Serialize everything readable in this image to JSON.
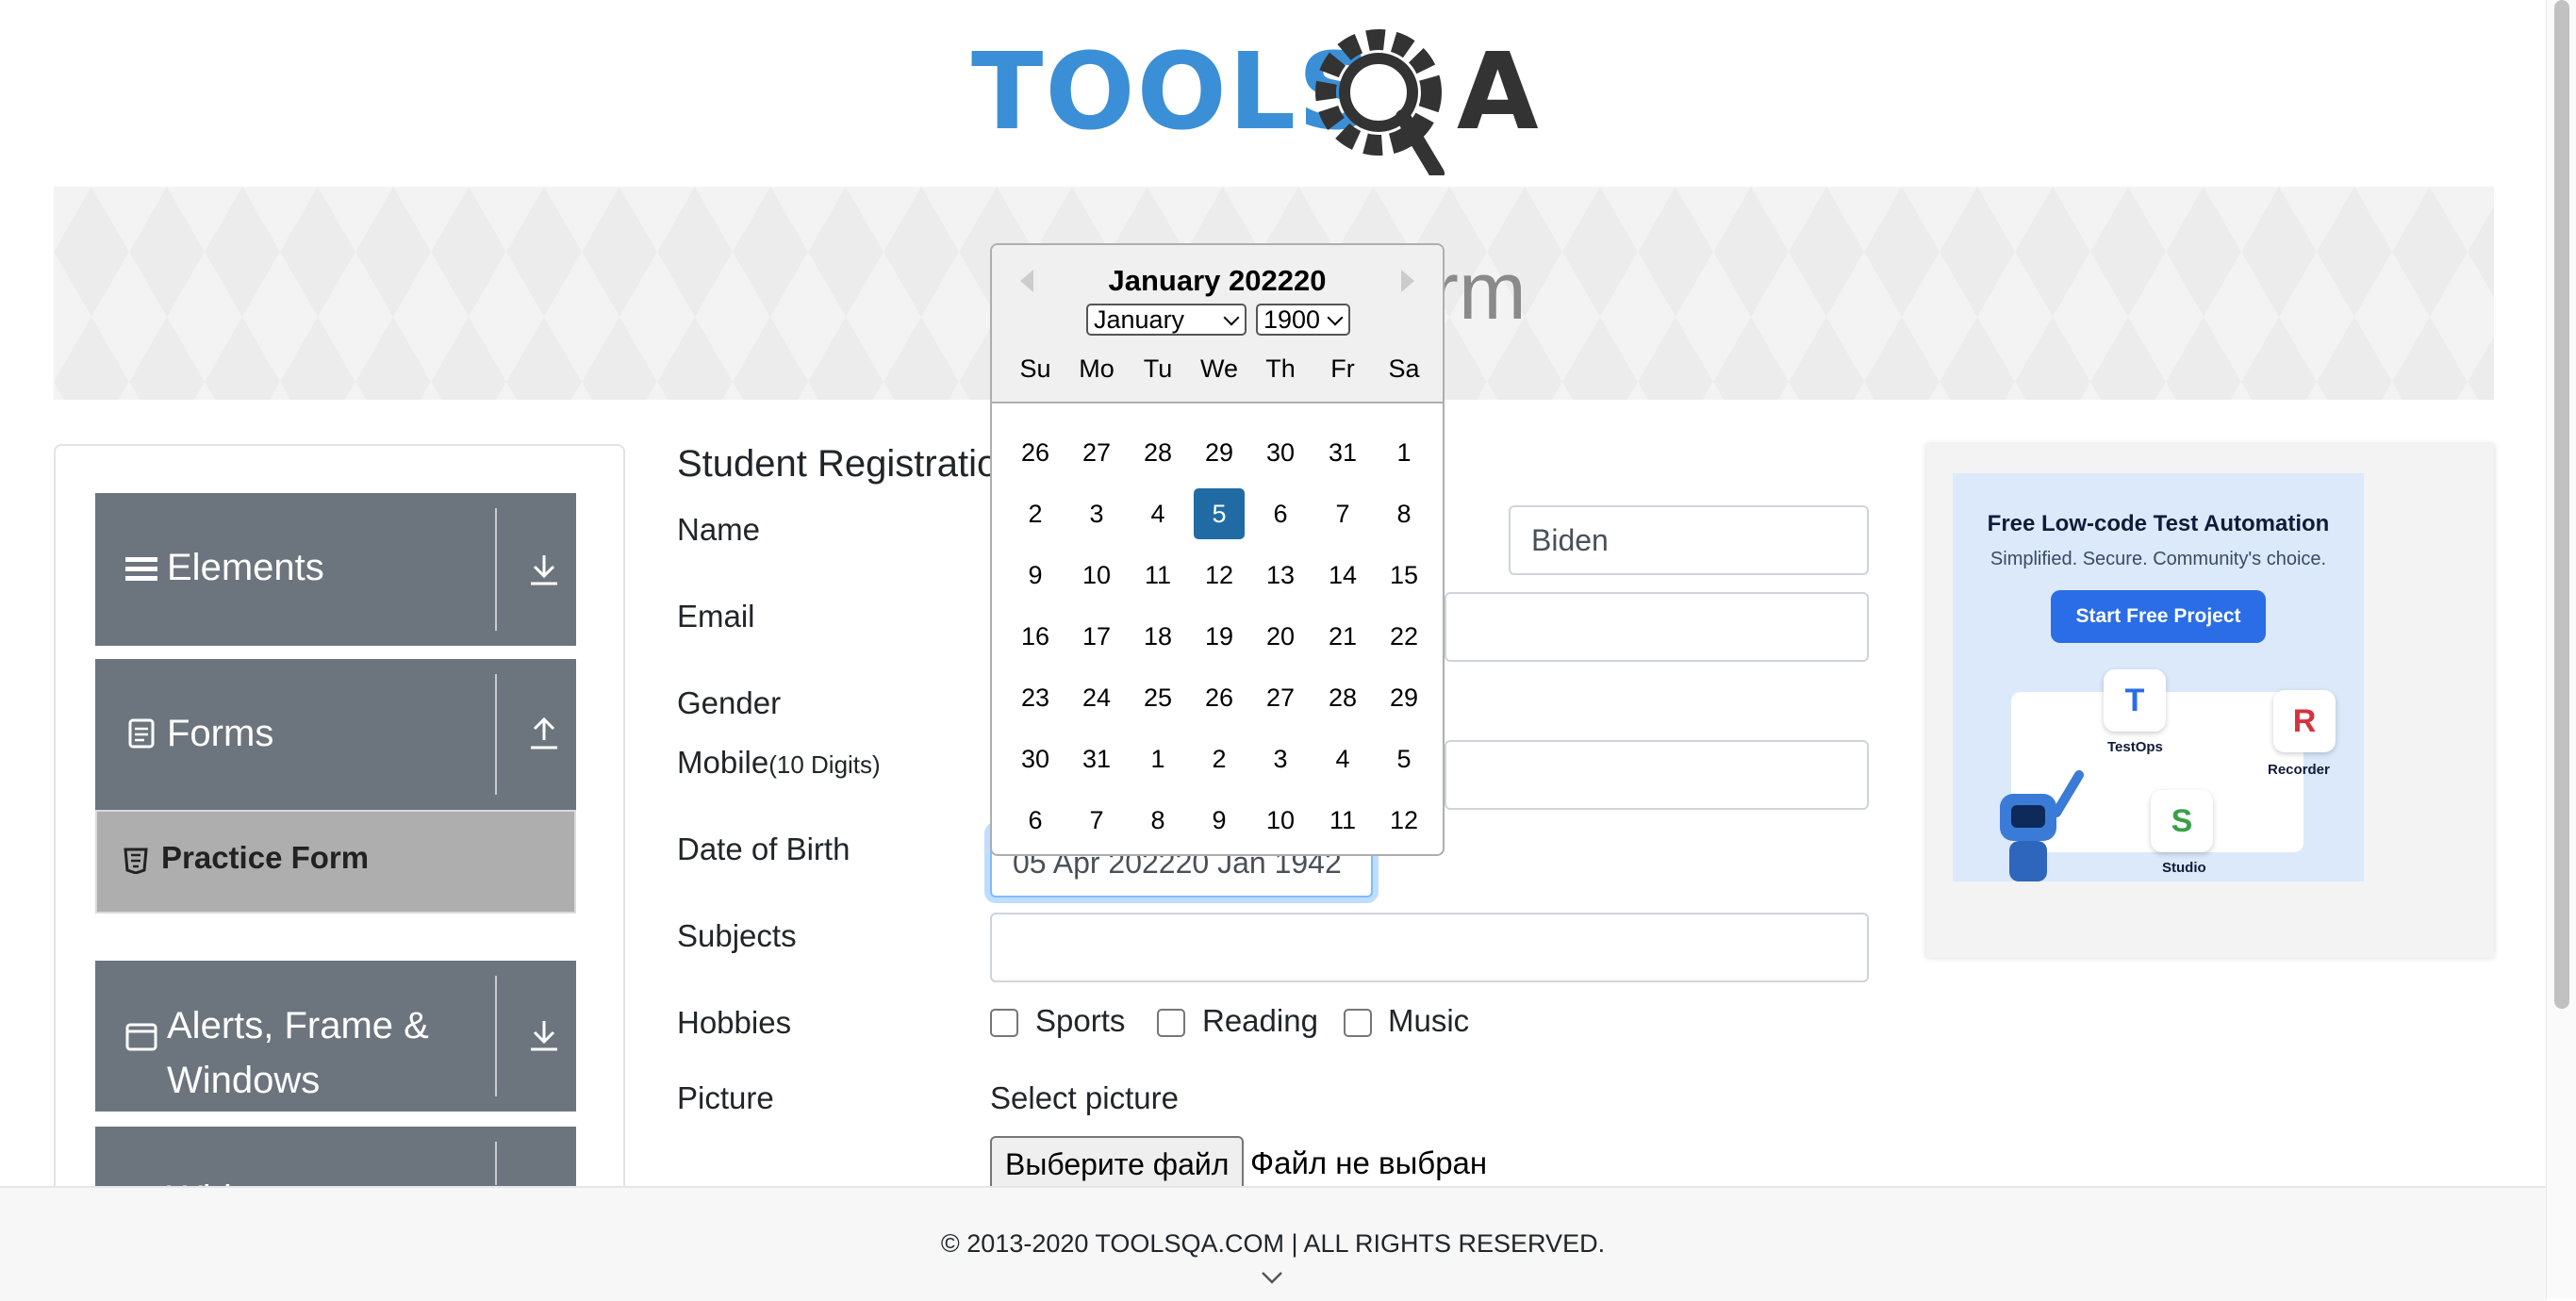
{
  "logo": {
    "text_tools": "TOOLS",
    "text_qa": "QA"
  },
  "banner": {
    "title": "Practice Form"
  },
  "sidebar": {
    "groups": [
      {
        "label": "Elements",
        "icon": "hamburger-icon",
        "arrow": "download-arrow-icon"
      },
      {
        "label": "Forms",
        "icon": "document-icon",
        "arrow": "upload-arrow-icon"
      },
      {
        "label": "Alerts, Frame & Windows",
        "icon": "window-icon",
        "arrow": "download-arrow-icon"
      },
      {
        "label": "Widgets",
        "icon": "widgets-icon",
        "arrow": "download-arrow-icon"
      }
    ],
    "active_item": {
      "label": "Practice Form",
      "icon": "html5-icon"
    }
  },
  "form": {
    "title": "Student Registration Form",
    "labels": {
      "name": "Name",
      "email": "Email",
      "gender": "Gender",
      "mobile": "Mobile",
      "mobile_hint": "(10 Digits)",
      "dob": "Date of Birth",
      "subjects": "Subjects",
      "hobbies": "Hobbies",
      "picture": "Picture"
    },
    "last_name_value": "Biden",
    "dob_value": "05 Apr 202220 Jan 1942",
    "subjects_value": "",
    "hobbies": [
      "Sports",
      "Reading",
      "Music"
    ],
    "select_picture": "Select picture",
    "file_button": "Выберите файл",
    "file_status": "Файл не выбран"
  },
  "datepicker": {
    "title": "January 202220",
    "month_select": "January",
    "year_select": "1900",
    "weekdays": [
      "Su",
      "Mo",
      "Tu",
      "We",
      "Th",
      "Fr",
      "Sa"
    ],
    "weeks": [
      [
        "26",
        "27",
        "28",
        "29",
        "30",
        "31",
        "1"
      ],
      [
        "2",
        "3",
        "4",
        "5",
        "6",
        "7",
        "8"
      ],
      [
        "9",
        "10",
        "11",
        "12",
        "13",
        "14",
        "15"
      ],
      [
        "16",
        "17",
        "18",
        "19",
        "20",
        "21",
        "22"
      ],
      [
        "23",
        "24",
        "25",
        "26",
        "27",
        "28",
        "29"
      ],
      [
        "30",
        "31",
        "1",
        "2",
        "3",
        "4",
        "5"
      ],
      [
        "6",
        "7",
        "8",
        "9",
        "10",
        "11",
        "12"
      ]
    ],
    "selected_day": "5",
    "colors": {
      "selected": "#216ba5"
    }
  },
  "ad": {
    "title": "Free Low-code Test Automation",
    "subtitle": "Simplified. Secure. Community's choice.",
    "button": "Start Free Project",
    "products": [
      "TestOps",
      "Recorder",
      "Studio"
    ]
  },
  "footer": {
    "text": "© 2013-2020 TOOLSQA.COM | ALL RIGHTS RESERVED."
  },
  "colors": {
    "sidebar_group": "#6c757d",
    "active_item": "#aeaeae",
    "logo_blue": "#3b8fd6",
    "logo_dark": "#333333"
  }
}
